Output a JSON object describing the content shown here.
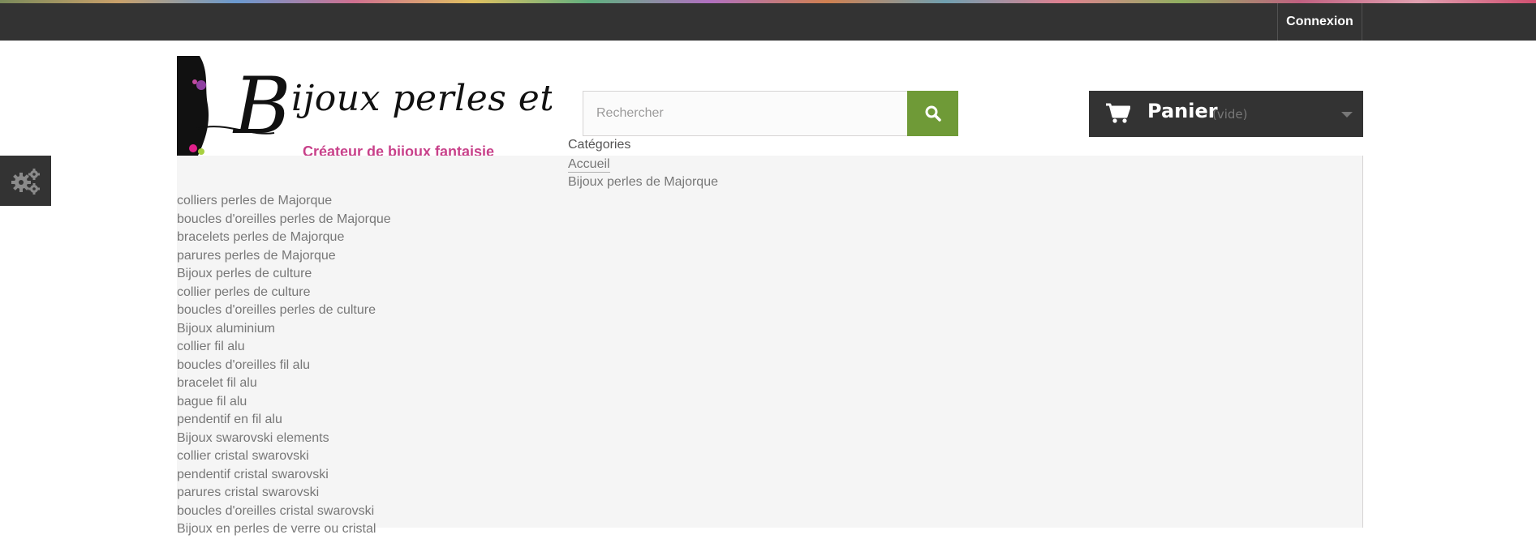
{
  "header": {
    "login_label": "Connexion"
  },
  "logo": {
    "brand_initial": "B",
    "brand_rest": "ijoux perles et pierres",
    "tagline": "Créateur de bijoux fantaisie",
    "tagline_color": "#c8418a"
  },
  "search": {
    "placeholder": "Rechercher",
    "button_icon": "search-icon",
    "button_color": "#6f9a37"
  },
  "cart": {
    "icon": "shopping-cart-icon",
    "label": "Panier",
    "status": "(vide)"
  },
  "settings": {
    "icon": "gears-icon"
  },
  "menu": {
    "title": "Catégories",
    "home": "Accueil",
    "top_category": "Bijoux perles de Majorque",
    "items": [
      "colliers perles de Majorque",
      "boucles d'oreilles perles de Majorque",
      "bracelets perles de Majorque",
      "parures perles de Majorque",
      "Bijoux perles de culture",
      "collier perles de culture",
      "boucles d'oreilles perles de culture",
      "Bijoux aluminium",
      "collier fil alu",
      "boucles d'oreilles fil alu",
      "bracelet fil alu",
      "bague fil alu",
      "pendentif en fil alu",
      "Bijoux swarovski elements",
      "collier cristal swarovski",
      "pendentif cristal swarovski",
      "parures cristal swarovski",
      "boucles d'oreilles cristal swarovski",
      "Bijoux en perles de verre ou cristal"
    ]
  }
}
